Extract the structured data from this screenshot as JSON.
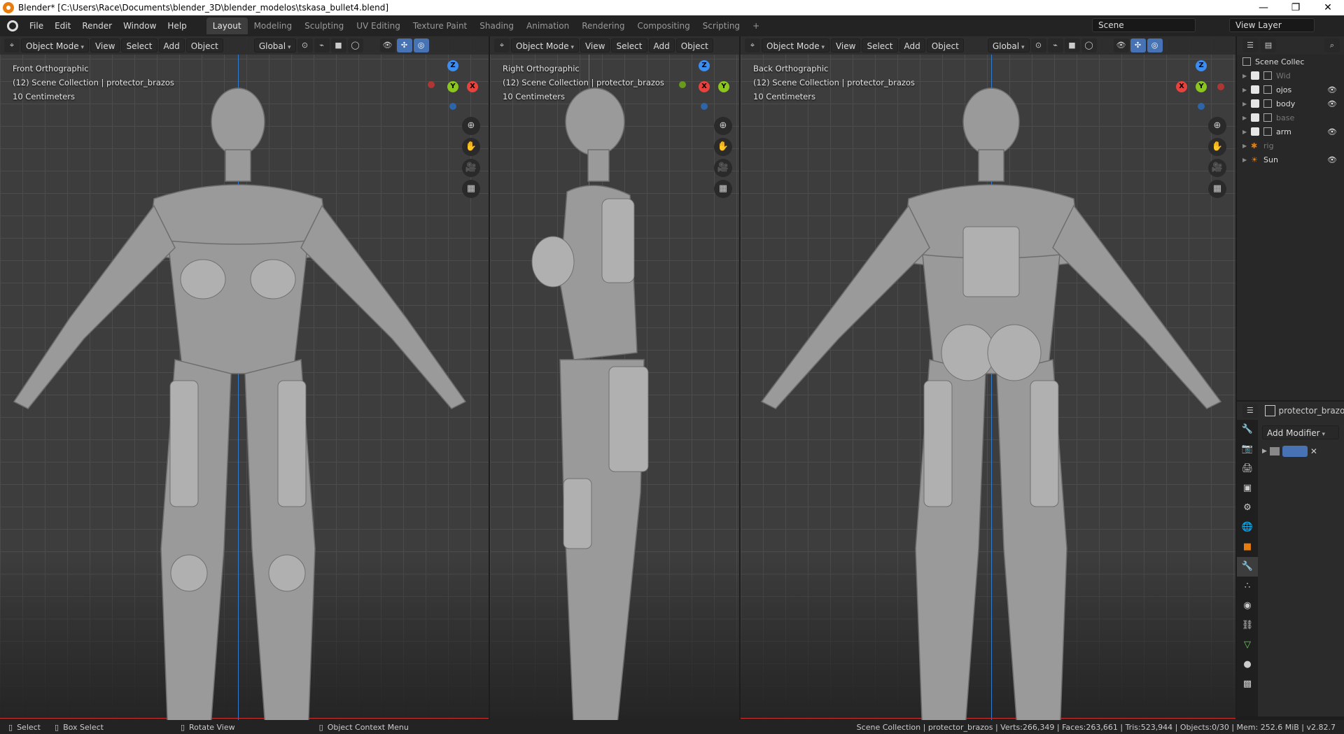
{
  "window": {
    "title": "Blender* [C:\\Users\\Race\\Documents\\blender_3D\\blender_modelos\\tskasa_bullet4.blend]",
    "minimize": "—",
    "maximize": "❐",
    "close": "✕"
  },
  "menu": [
    "File",
    "Edit",
    "Render",
    "Window",
    "Help"
  ],
  "workspaces": [
    "Layout",
    "Modeling",
    "Sculpting",
    "UV Editing",
    "Texture Paint",
    "Shading",
    "Animation",
    "Rendering",
    "Compositing",
    "Scripting",
    "+"
  ],
  "active_workspace": "Layout",
  "scene": "Scene",
  "view_layer": "View Layer",
  "viewports": [
    {
      "mode": "Object Mode",
      "view": "View",
      "select": "Select",
      "add": "Add",
      "object": "Object",
      "orientation": "Global",
      "title": "Front Orthographic",
      "collection": "(12) Scene Collection | protector_brazos",
      "scale": "10 Centimeters",
      "gizmo": {
        "top": "Z",
        "left": "Y",
        "right": "X"
      }
    },
    {
      "mode": "Object Mode",
      "view": "View",
      "select": "Select",
      "add": "Add",
      "object": "Object",
      "title": "Right Orthographic",
      "collection": "(12) Scene Collection | protector_brazos",
      "scale": "10 Centimeters",
      "gizmo": {
        "top": "Z",
        "left": "X",
        "right": "Y"
      }
    },
    {
      "mode": "Object Mode",
      "view": "View",
      "select": "Select",
      "add": "Add",
      "object": "Object",
      "orientation": "Global",
      "title": "Back Orthographic",
      "collection": "(12) Scene Collection | protector_brazos",
      "scale": "10 Centimeters",
      "gizmo": {
        "top": "Z",
        "left": "X",
        "right": "Y"
      }
    }
  ],
  "outliner": {
    "root": "Scene Collec",
    "items": [
      "Wid",
      "ojos",
      "body",
      "base",
      "arm",
      "rig",
      "Sun"
    ]
  },
  "properties": {
    "object": "protector_brazo",
    "add_modifier": "Add Modifier"
  },
  "status": {
    "select": "Select",
    "box_select": "Box Select",
    "rotate_view": "Rotate View",
    "context_menu": "Object Context Menu",
    "stats": "Scene Collection | protector_brazos | Verts:266,349 | Faces:263,661 | Tris:523,944 | Objects:0/30 | Mem: 252.6 MiB | v2.82.7"
  },
  "colors": {
    "accent": "#4772b3",
    "x_axis": "#e8423f",
    "y_axis": "#8bc61e",
    "z_axis": "#3b8df0"
  }
}
